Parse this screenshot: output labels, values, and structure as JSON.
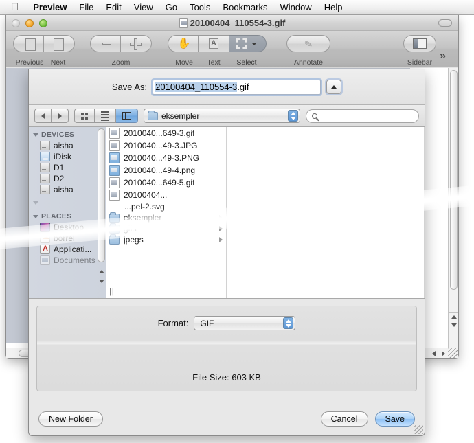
{
  "menubar": {
    "apple_icon": "apple-logo",
    "items": [
      {
        "label": "Preview",
        "bold": true
      },
      {
        "label": "File",
        "bold": false
      },
      {
        "label": "Edit",
        "bold": false
      },
      {
        "label": "View",
        "bold": false
      },
      {
        "label": "Go",
        "bold": false
      },
      {
        "label": "Tools",
        "bold": false
      },
      {
        "label": "Bookmarks",
        "bold": false
      },
      {
        "label": "Window",
        "bold": false
      },
      {
        "label": "Help",
        "bold": false
      }
    ]
  },
  "window": {
    "title": "20100404_110554-3.gif",
    "toolbar": {
      "previous": "Previous",
      "next": "Next",
      "zoom": "Zoom",
      "move": "Move",
      "text": "Text",
      "select": "Select",
      "annotate": "Annotate",
      "sidebar": "Sidebar",
      "overflow": "»"
    }
  },
  "sheet": {
    "save_as_label": "Save As:",
    "filename_selected": "20100404_110554-3",
    "filename_extension": ".gif",
    "filename_full": "20100404_110554-3.gif",
    "search_placeholder": "",
    "current_folder": "eksempler",
    "view_mode": "column",
    "sidebar": {
      "sections": [
        {
          "title": "DEVICES",
          "items": [
            {
              "label": "aisha",
              "icon": "hard-disk-icon"
            },
            {
              "label": "iDisk",
              "icon": "idisk-icon"
            },
            {
              "label": "D1",
              "icon": "hard-disk-icon"
            },
            {
              "label": "D2",
              "icon": "hard-disk-icon"
            },
            {
              "label": "aisha",
              "icon": "hard-disk-icon"
            }
          ]
        },
        {
          "title": "PLACES",
          "items": [
            {
              "label": "Desktop",
              "icon": "desktop-icon"
            },
            {
              "label": "borrel",
              "icon": "home-icon"
            },
            {
              "label": "Applicati...",
              "icon": "applications-icon"
            },
            {
              "label": "Documents",
              "icon": "documents-icon"
            }
          ]
        }
      ]
    },
    "files": [
      {
        "label": "2010040...649-3.gif",
        "icon": "generic-image-file-icon",
        "kind": "file"
      },
      {
        "label": "2010040...49-3.JPG",
        "icon": "generic-image-file-icon",
        "kind": "file"
      },
      {
        "label": "2010040...49-3.PNG",
        "icon": "png-file-icon",
        "kind": "file"
      },
      {
        "label": "2010040...49-4.png",
        "icon": "png-file-icon",
        "kind": "file"
      },
      {
        "label": "2010040...649-5.gif",
        "icon": "generic-image-file-icon",
        "kind": "file"
      },
      {
        "label": "20100404...",
        "icon": "generic-image-file-icon",
        "kind": "file"
      },
      {
        "label": "...pel-2.svg",
        "icon": "svg-file-icon",
        "kind": "file"
      },
      {
        "label": "eksempler",
        "icon": "folder-icon",
        "kind": "folder"
      },
      {
        "label": "gifs",
        "icon": "folder-icon",
        "kind": "folder"
      },
      {
        "label": "jpegs",
        "icon": "folder-icon",
        "kind": "folder"
      }
    ],
    "format_label": "Format:",
    "format_value": "GIF",
    "file_size_text": "File Size:  603 KB",
    "new_folder_button": "New Folder",
    "cancel_button": "Cancel",
    "save_button": "Save"
  },
  "colors": {
    "accent": "#7fb0e2",
    "selection": "#b8d0ea",
    "sidebar_bg": "#d2d7e0",
    "sheet_bg": "#e8e8e8"
  }
}
